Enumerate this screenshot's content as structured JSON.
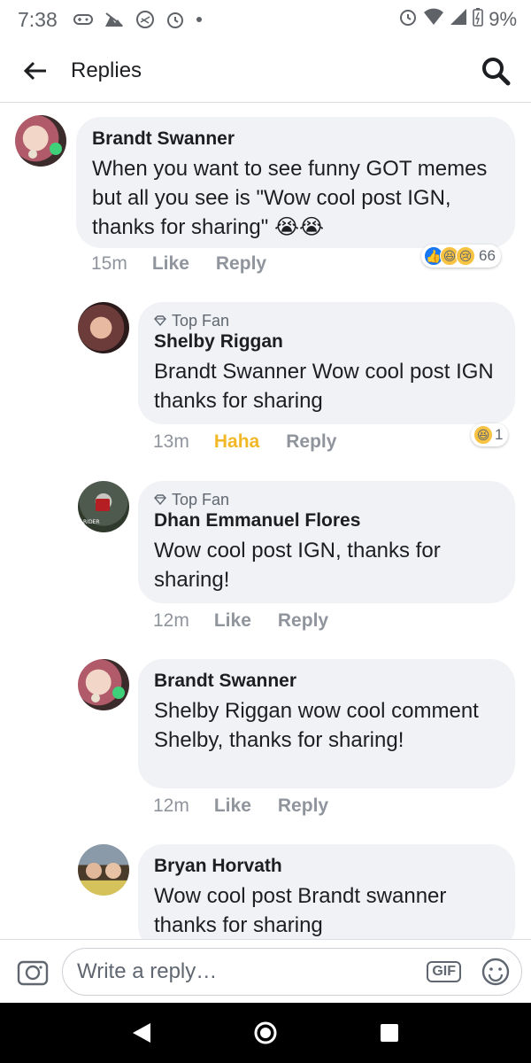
{
  "status_bar": {
    "time": "7:38",
    "battery": "9%"
  },
  "header": {
    "title": "Replies"
  },
  "comments": [
    {
      "author": "Brandt Swanner",
      "text": "When you want to see funny GOT memes but all you see is \"Wow cool post IGN, thanks for sharing\" 😭😭",
      "time": "15m",
      "action1": "Like",
      "action2": "Reply",
      "reaction_count": "66"
    },
    {
      "badge": "Top Fan",
      "author": "Shelby Riggan",
      "text": "Brandt Swanner Wow cool post IGN thanks for sharing",
      "time": "13m",
      "action1": "Haha",
      "action2": "Reply",
      "reaction_count": "1"
    },
    {
      "badge": "Top Fan",
      "author": "Dhan Emmanuel Flores",
      "text": "Wow cool post IGN, thanks for sharing!",
      "time": "12m",
      "action1": "Like",
      "action2": "Reply"
    },
    {
      "author": "Brandt Swanner",
      "text": "Shelby Riggan wow cool comment Shelby, thanks for sharing!",
      "time": "12m",
      "action1": "Like",
      "action2": "Reply"
    },
    {
      "author": "Bryan Horvath",
      "text": "Wow cool post Brandt swanner thanks for sharing"
    }
  ],
  "composer": {
    "placeholder": "Write a reply…",
    "gif_label": "GIF"
  },
  "colors": {
    "bubble": "#f0f2f5",
    "haha_active": "#f2b724",
    "like_blue": "#1877f2"
  }
}
